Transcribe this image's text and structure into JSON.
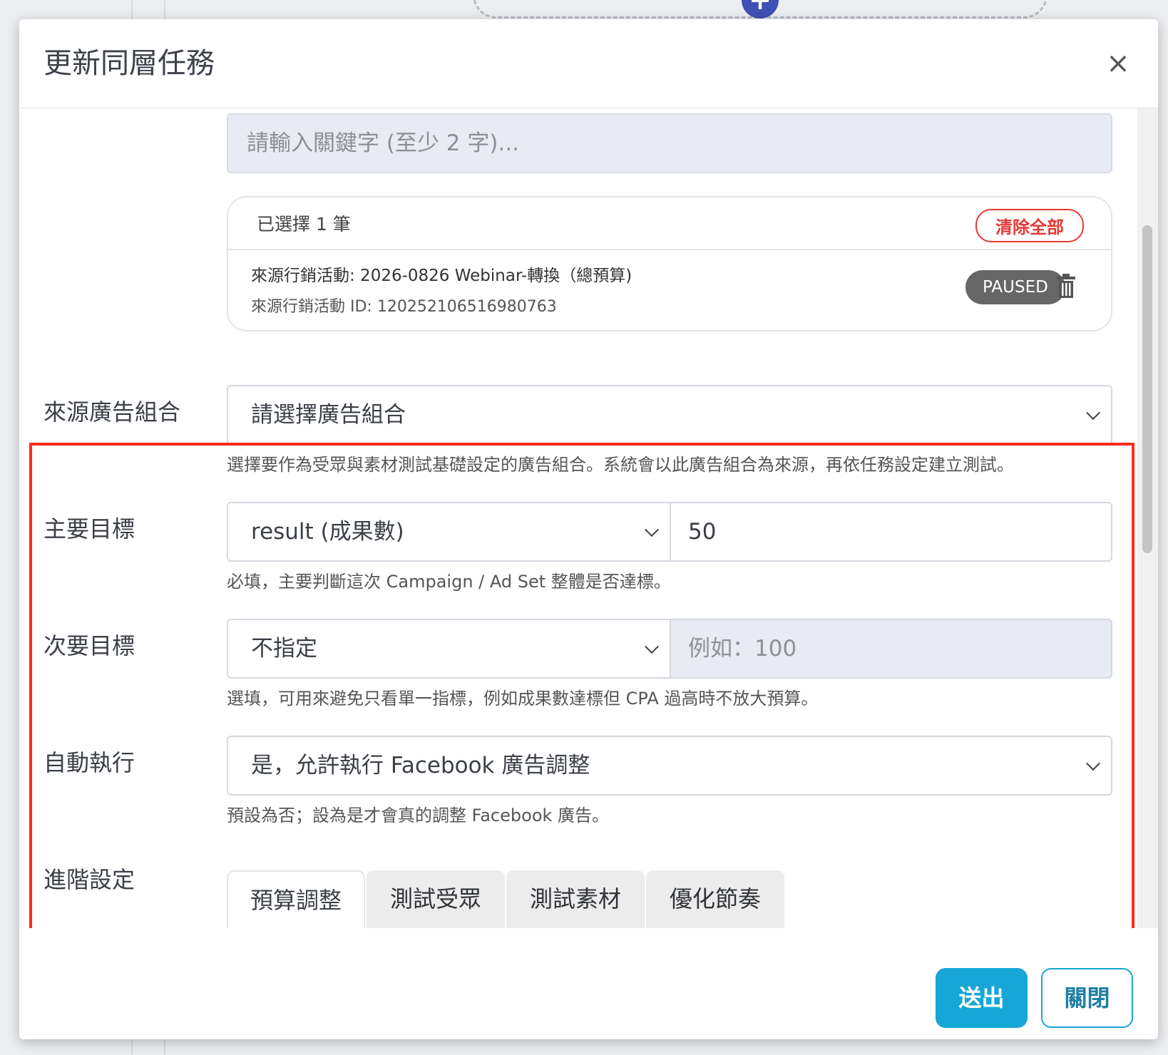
{
  "modal": {
    "title": "更新同層任務",
    "close_icon": "×"
  },
  "search": {
    "placeholder": "請輸入關鍵字 (至少 2 字)..."
  },
  "selected": {
    "count_label": "已選擇 1 筆",
    "clear_all_label": "清除全部",
    "item": {
      "name": "來源行銷活動: 2026-0826 Webinar-轉換（總預算)",
      "id": "來源行銷活動 ID: 120252106516980763",
      "status": "PAUSED"
    }
  },
  "form": {
    "source_adset": {
      "label": "來源廣告組合",
      "value": "請選擇廣告組合",
      "help": "選擇要作為受眾與素材測試基礎設定的廣告組合。系統會以此廣告組合為來源，再依任務設定建立測試。"
    },
    "primary_goal": {
      "label": "主要目標",
      "metric": "result (成果數)",
      "target": "50",
      "help": "必填，主要判斷這次 Campaign / Ad Set 整體是否達標。"
    },
    "secondary_goal": {
      "label": "次要目標",
      "metric": "不指定",
      "target_placeholder": "例如：100",
      "help": "選填，可用來避免只看單一指標，例如成果數達標但 CPA 過高時不放大預算。"
    },
    "auto_execute": {
      "label": "自動執行",
      "value": "是，允許執行 Facebook 廣告調整",
      "help": "預設為否；設為是才會真的調整 Facebook 廣告。"
    },
    "advanced": {
      "label": "進階設定",
      "tabs": [
        "預算調整",
        "測試受眾",
        "測試素材",
        "優化節奏"
      ],
      "active_tab": 0
    }
  },
  "footer": {
    "submit_label": "送出",
    "close_label": "關閉"
  },
  "colors": {
    "accent": "#16a7d6",
    "danger": "#e53935",
    "highlight": "#ff2b1c",
    "badge": "#666666"
  }
}
